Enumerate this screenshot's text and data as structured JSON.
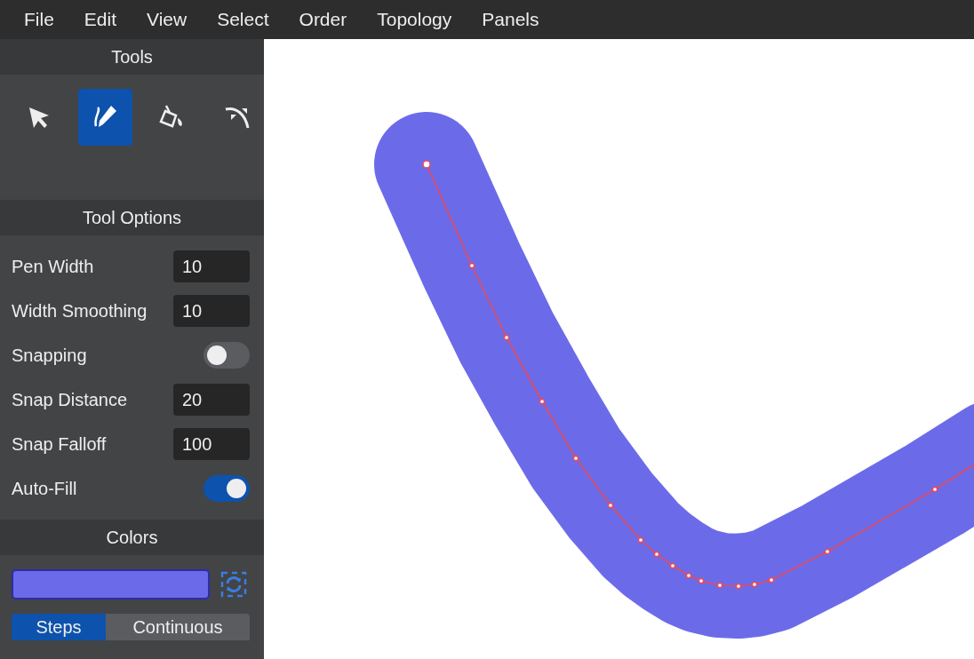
{
  "menu": [
    "File",
    "Edit",
    "View",
    "Select",
    "Order",
    "Topology",
    "Panels"
  ],
  "tools_panel": {
    "title": "Tools",
    "tools": [
      {
        "kind": "select",
        "selected": false
      },
      {
        "kind": "pen",
        "selected": true
      },
      {
        "kind": "fill",
        "selected": false
      },
      {
        "kind": "sculpt",
        "selected": false
      }
    ]
  },
  "tool_options": {
    "title": "Tool Options",
    "rows": [
      {
        "kind": "number",
        "label": "Pen Width",
        "value": "10"
      },
      {
        "kind": "number",
        "label": "Width Smoothing",
        "value": "10"
      },
      {
        "kind": "toggle",
        "label": "Snapping",
        "on": false
      },
      {
        "kind": "number",
        "label": "Snap Distance",
        "value": "20"
      },
      {
        "kind": "number",
        "label": "Snap Falloff",
        "value": "100"
      },
      {
        "kind": "toggle",
        "label": "Auto-Fill",
        "on": true
      }
    ]
  },
  "colors": {
    "title": "Colors",
    "color": "#6b6bea",
    "modes": [
      {
        "label": "Steps",
        "selected": true
      },
      {
        "label": "Continuous",
        "selected": false
      }
    ]
  }
}
